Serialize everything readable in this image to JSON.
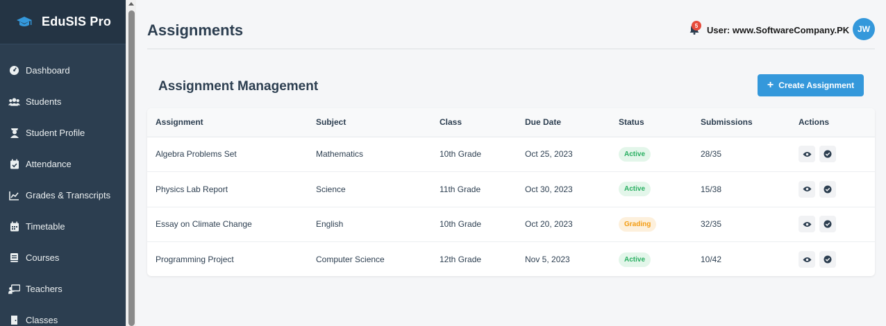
{
  "brand": {
    "name": "EduSIS Pro",
    "icon": "graduation-cap-icon"
  },
  "sidebar": {
    "items": [
      {
        "label": "Dashboard",
        "icon": "dashboard-icon"
      },
      {
        "label": "Students",
        "icon": "users-icon"
      },
      {
        "label": "Student Profile",
        "icon": "user-graduate-icon"
      },
      {
        "label": "Attendance",
        "icon": "calendar-check-icon"
      },
      {
        "label": "Grades & Transcripts",
        "icon": "chart-line-icon"
      },
      {
        "label": "Timetable",
        "icon": "calendar-icon"
      },
      {
        "label": "Courses",
        "icon": "book-icon"
      },
      {
        "label": "Teachers",
        "icon": "chalkboard-teacher-icon"
      },
      {
        "label": "Classes",
        "icon": "door-icon"
      }
    ]
  },
  "header": {
    "title": "Assignments",
    "notification_count": "5",
    "user_label": "User: www.SoftwareCompany.PK",
    "avatar_initials": "JW"
  },
  "section": {
    "title": "Assignment Management",
    "create_button": "Create Assignment"
  },
  "table": {
    "columns": [
      "Assignment",
      "Subject",
      "Class",
      "Due Date",
      "Status",
      "Submissions",
      "Actions"
    ],
    "rows": [
      {
        "assignment": "Algebra Problems Set",
        "subject": "Mathematics",
        "class": "10th Grade",
        "due": "Oct 25, 2023",
        "status": "Active",
        "submissions": "28/35"
      },
      {
        "assignment": "Physics Lab Report",
        "subject": "Science",
        "class": "11th Grade",
        "due": "Oct 30, 2023",
        "status": "Active",
        "submissions": "15/38"
      },
      {
        "assignment": "Essay on Climate Change",
        "subject": "English",
        "class": "10th Grade",
        "due": "Oct 20, 2023",
        "status": "Grading",
        "submissions": "32/35"
      },
      {
        "assignment": "Programming Project",
        "subject": "Computer Science",
        "class": "12th Grade",
        "due": "Nov 5, 2023",
        "status": "Active",
        "submissions": "10/42"
      }
    ]
  },
  "colors": {
    "sidebar_bg": "#2c3e50",
    "accent": "#3498db",
    "active_status": "#27ae60",
    "grading_status": "#f39c12",
    "badge": "#e74c3c"
  }
}
